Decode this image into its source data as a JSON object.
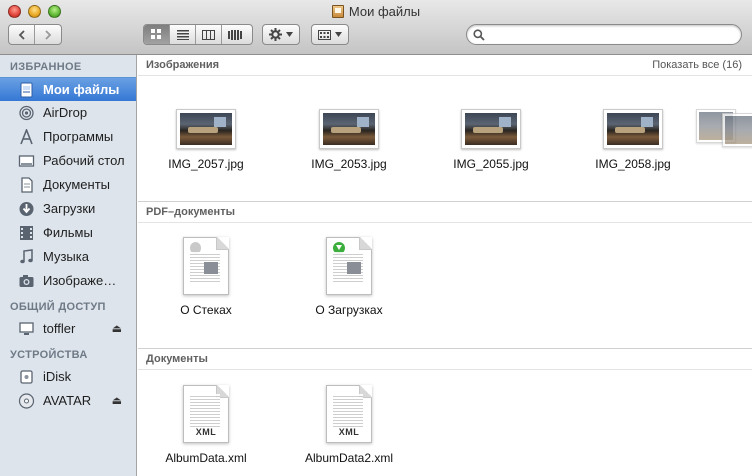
{
  "window": {
    "title": "Мои файлы"
  },
  "toolbar": {
    "back_icon": "chevron-left-icon",
    "forward_icon": "chevron-right-icon",
    "view_modes": [
      "icon-view",
      "list-view",
      "column-view",
      "coverflow-view"
    ],
    "active_view": "icon-view",
    "action_icon": "gear-icon",
    "arrange_icon": "arrange-grid-icon",
    "search": {
      "value": "",
      "placeholder": ""
    }
  },
  "sidebar": {
    "favorites_header": "ИЗБРАННОЕ",
    "favorites": [
      {
        "label": "Мои файлы",
        "icon": "all-my-files-icon",
        "selected": true
      },
      {
        "label": "AirDrop",
        "icon": "airdrop-icon"
      },
      {
        "label": "Программы",
        "icon": "applications-icon"
      },
      {
        "label": "Рабочий стол",
        "icon": "desktop-icon"
      },
      {
        "label": "Документы",
        "icon": "documents-icon"
      },
      {
        "label": "Загрузки",
        "icon": "downloads-icon"
      },
      {
        "label": "Фильмы",
        "icon": "movies-icon"
      },
      {
        "label": "Музыка",
        "icon": "music-icon"
      },
      {
        "label": "Изображе…",
        "icon": "pictures-icon"
      }
    ],
    "shared_header": "ОБЩИЙ ДОСТУП",
    "shared": [
      {
        "label": "toffler",
        "icon": "computer-icon",
        "eject": true
      }
    ],
    "devices_header": "УСТРОЙСТВА",
    "devices": [
      {
        "label": "iDisk",
        "icon": "idisk-icon"
      },
      {
        "label": "AVATAR",
        "icon": "disc-icon",
        "eject": true
      }
    ]
  },
  "sections": {
    "images": {
      "title": "Изображения",
      "show_all": "Показать все (16)",
      "files": [
        "IMG_2057.jpg",
        "IMG_2053.jpg",
        "IMG_2055.jpg",
        "IMG_2058.jpg"
      ]
    },
    "pdf": {
      "title": "PDF–документы",
      "files": [
        "О Стеках",
        "О Загрузках"
      ]
    },
    "documents": {
      "title": "Документы",
      "files": [
        "AlbumData.xml",
        "AlbumData2.xml"
      ],
      "file_tag": "XML"
    }
  }
}
